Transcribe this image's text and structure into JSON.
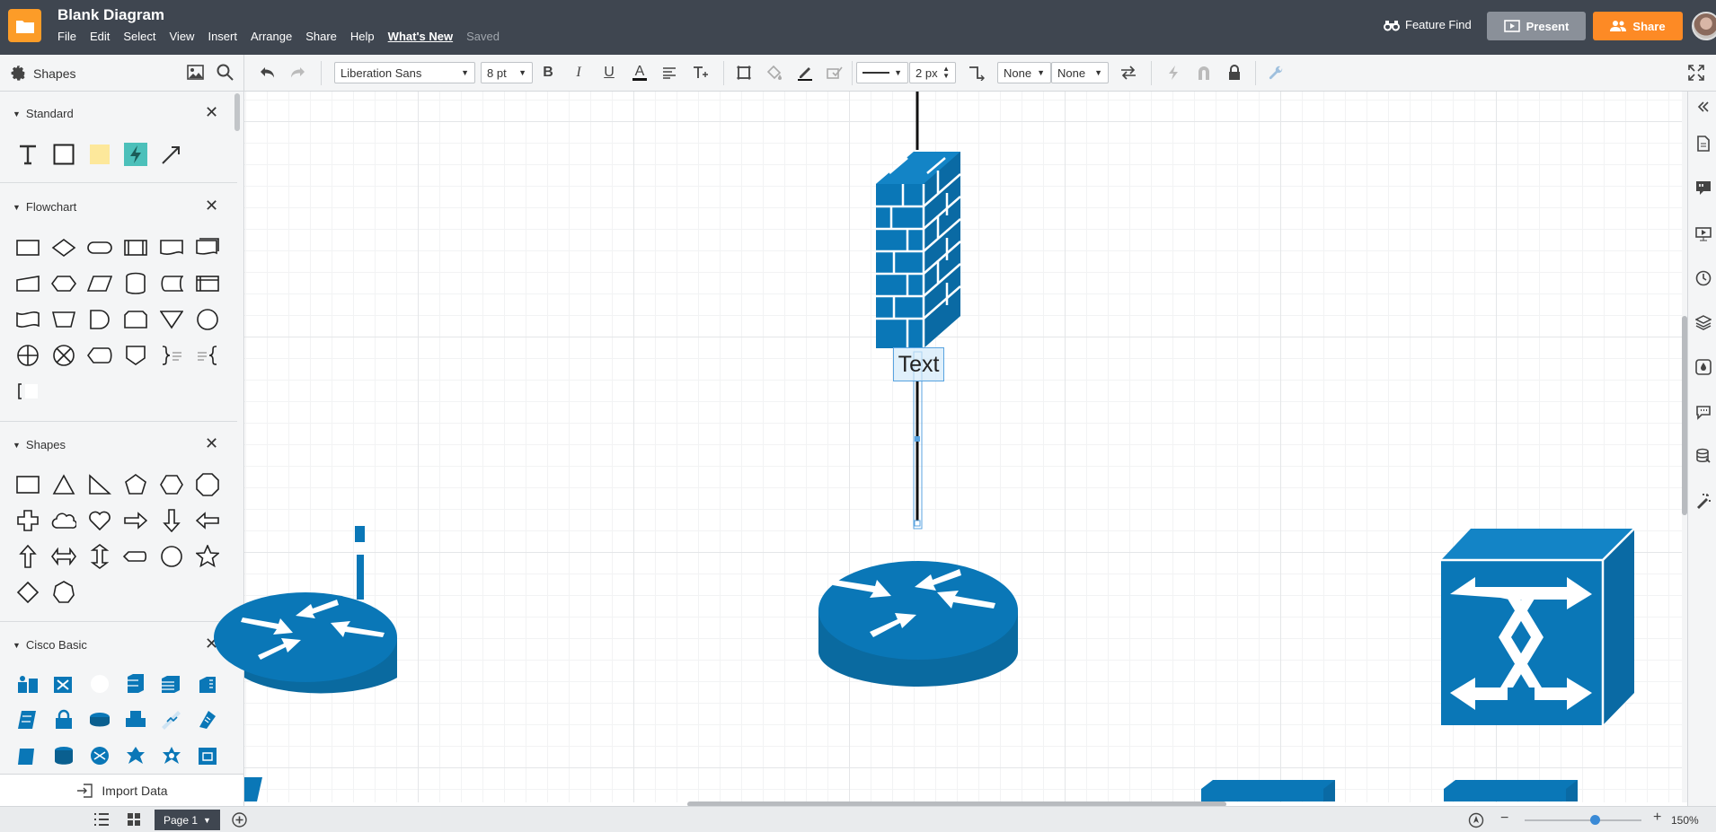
{
  "header": {
    "title": "Blank Diagram",
    "menu": [
      "File",
      "Edit",
      "Select",
      "View",
      "Insert",
      "Arrange",
      "Share",
      "Help"
    ],
    "whats_new": "What's New",
    "saved_status": "Saved",
    "feature_find": "Feature Find",
    "present": "Present",
    "share": "Share"
  },
  "toolbar": {
    "shapes_label": "Shapes",
    "font_family": "Liberation Sans",
    "font_size": "8 pt",
    "line_width": "2 px",
    "arrow_start": "None",
    "arrow_end": "None"
  },
  "left_panel": {
    "sections": [
      {
        "title": "Standard"
      },
      {
        "title": "Flowchart"
      },
      {
        "title": "Shapes"
      },
      {
        "title": "Cisco Basic"
      }
    ],
    "import_data": "Import Data"
  },
  "canvas": {
    "text_label": "Text"
  },
  "footer": {
    "page_tab": "Page 1",
    "zoom": "150%"
  },
  "colors": {
    "header_bg": "#3f4650",
    "accent_orange": "#fd8a25",
    "cisco_blue": "#0a77b7",
    "cisco_dark": "#0a5f8f"
  }
}
